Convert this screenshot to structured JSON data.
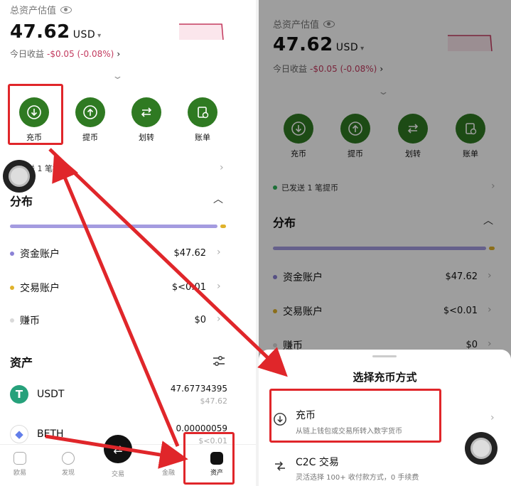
{
  "left": {
    "total_label": "总资产估值",
    "amount": "47.62",
    "currency": "USD",
    "pnl_label": "今日收益",
    "pnl_value": "-$0.05 (-0.08%)",
    "actions": [
      {
        "label": "充币",
        "icon": "download-icon"
      },
      {
        "label": "提币",
        "icon": "upload-icon"
      },
      {
        "label": "划转",
        "icon": "transfer-icon"
      },
      {
        "label": "账单",
        "icon": "bill-icon"
      }
    ],
    "notice": "已发送 1 笔提币",
    "notice_partial": "送 1 笔提币",
    "distribution_title": "分布",
    "accounts": [
      {
        "name": "资金账户",
        "value": "$47.62",
        "color": "#8b82d6"
      },
      {
        "name": "交易账户",
        "value": "$<0.01",
        "color": "#e0b22b"
      },
      {
        "name": "赚币",
        "value": "$0",
        "color": "#d9d9d9"
      }
    ],
    "assets_title": "资产",
    "assets": [
      {
        "name": "USDT",
        "value": "47.67734395",
        "sub": "$47.62",
        "color": "#26a17b",
        "symbol": "T"
      },
      {
        "name": "BETH",
        "value": "0.00000059",
        "sub": "$<0.01",
        "color": "#627eea",
        "symbol": "◆"
      }
    ],
    "tabs": [
      {
        "label": "欧易",
        "icon": "home-icon"
      },
      {
        "label": "发现",
        "icon": "discover-icon"
      },
      {
        "label": "交易",
        "icon": "trade-icon"
      },
      {
        "label": "金融",
        "icon": "finance-icon"
      },
      {
        "label": "资产",
        "icon": "wallet-icon",
        "active": true
      }
    ]
  },
  "right": {
    "total_label": "总资产估值",
    "amount": "47.62",
    "currency": "USD",
    "pnl_label": "今日收益",
    "pnl_value": "-$0.05 (-0.08%)",
    "actions": [
      {
        "label": "充币"
      },
      {
        "label": "提币"
      },
      {
        "label": "划转"
      },
      {
        "label": "账单"
      }
    ],
    "notice": "已发送 1 笔提币",
    "distribution_title": "分布",
    "accounts": [
      {
        "name": "资金账户",
        "value": "$47.62"
      },
      {
        "name": "交易账户",
        "value": "$<0.01"
      },
      {
        "name": "赚币",
        "value": "$0"
      }
    ],
    "sheet": {
      "title": "选择充币方式",
      "options": [
        {
          "title": "充币",
          "desc": "从链上钱包或交易所转入数字货币",
          "icon": "download-icon"
        },
        {
          "title": "C2C 交易",
          "desc": "灵活选择 100+ 收付款方式，0 手续费",
          "icon": "c2c-icon"
        }
      ]
    }
  },
  "colors": {
    "accent_green": "#2f7a22",
    "negative": "#c33b5f",
    "annotation_red": "#e0262a"
  }
}
